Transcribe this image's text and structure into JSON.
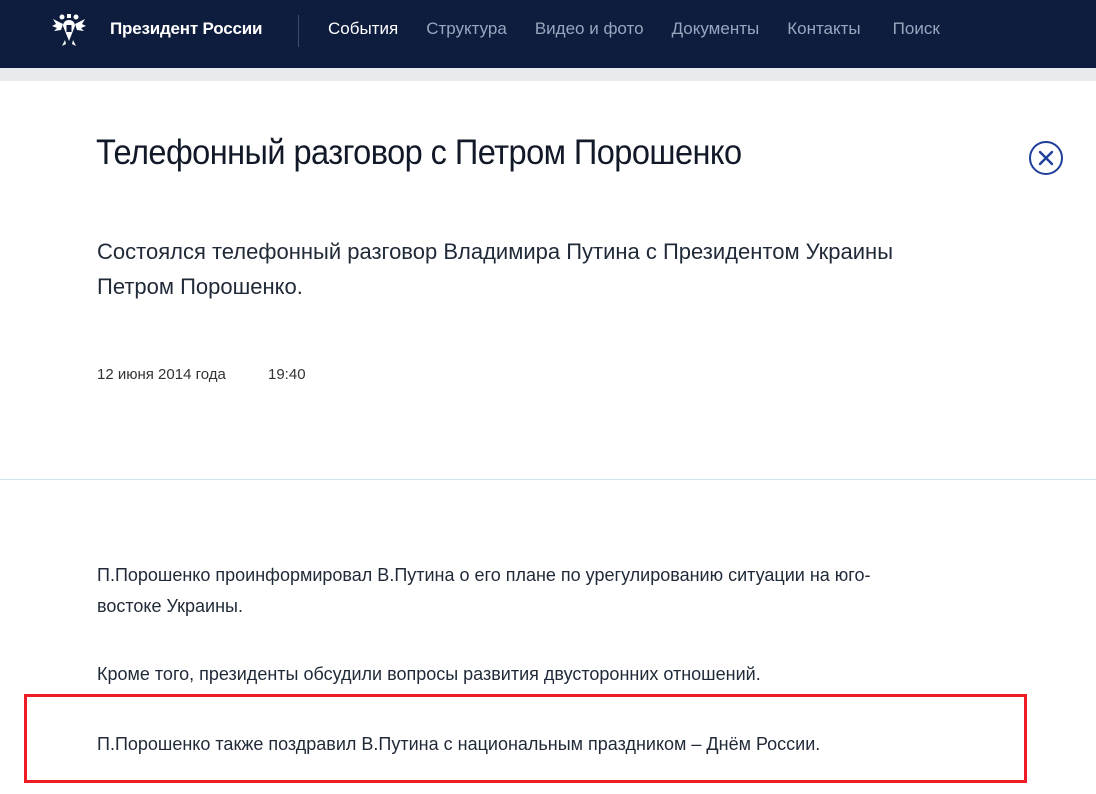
{
  "header": {
    "site_title": "Президент России",
    "nav": [
      "События",
      "Структура",
      "Видео и фото",
      "Документы",
      "Контакты",
      "Поиск"
    ],
    "active_nav": "События",
    "emblem_icon": "double-headed-eagle-icon"
  },
  "article": {
    "title": "Телефонный разговор с Петром Порошенко",
    "lead": "Состоялся телефонный разговор Владимира Путина с Президентом Украины Петром Порошенко.",
    "date": "12 июня 2014 года",
    "time": "19:40",
    "paragraphs": [
      "П.Порошенко проинформировал В.Путина о его плане по урегулированию ситуации на юго-востоке Украины.",
      "Кроме того, президенты обсудили вопросы развития двусторонних отношений.",
      "П.Порошенко также поздравил В.Путина с национальным праздником – Днём России."
    ],
    "close_icon": "close-circle-icon"
  },
  "colors": {
    "header_bg": "#0e1c3e",
    "accent": "#1f3f9a",
    "highlight_border": "#ee1c25"
  }
}
